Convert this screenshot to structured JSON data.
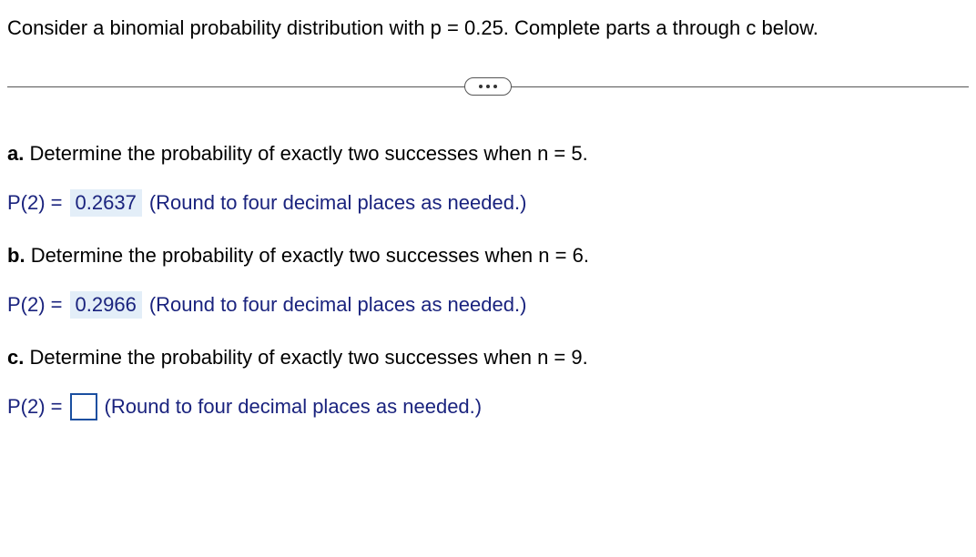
{
  "intro": "Consider a binomial probability distribution with p = 0.25. Complete parts a through c below.",
  "parts": {
    "a": {
      "label": "a.",
      "prompt": "Determine the probability of exactly two successes when n = 5.",
      "prefix": "P(2) =",
      "value": "0.2637",
      "hint": "(Round to four decimal places as needed.)"
    },
    "b": {
      "label": "b.",
      "prompt": "Determine the probability of exactly two successes when n = 6.",
      "prefix": "P(2) =",
      "value": "0.2966",
      "hint": "(Round to four decimal places as needed.)"
    },
    "c": {
      "label": "c.",
      "prompt": "Determine the probability of exactly two successes when n = 9.",
      "prefix": "P(2) =",
      "value": "",
      "hint": "(Round to four decimal places as needed.)"
    }
  }
}
